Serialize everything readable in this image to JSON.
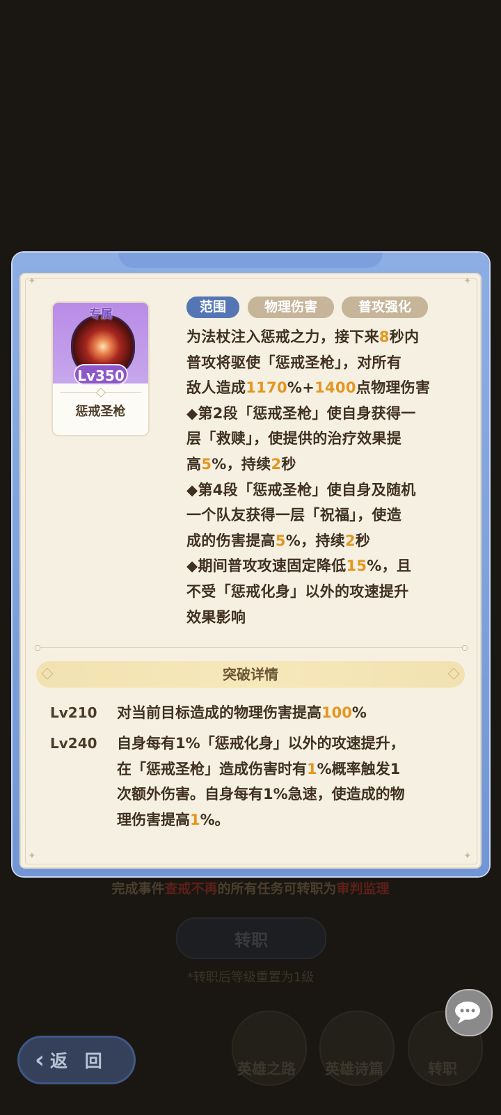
{
  "background": {
    "description_parts": [
      "完成事件",
      "查戒不再",
      "的所有任务可转职为",
      "审判监理"
    ],
    "job_change_button": "转职",
    "note": "*转职后等级重置为1级",
    "nav": [
      {
        "label": "英雄之路"
      },
      {
        "label": "英雄诗篇"
      },
      {
        "label": "转职"
      }
    ],
    "back_button": "返 回"
  },
  "skill": {
    "badge": "专属",
    "level": "Lv350",
    "name": "惩戒圣枪",
    "icon": "holy-spear-icon"
  },
  "tags": [
    "范围",
    "物理伤害",
    "普攻强化"
  ],
  "description_lines": [
    [
      {
        "t": "为法杖注入惩戒之力，接下来"
      },
      {
        "t": "8",
        "n": true
      },
      {
        "t": "秒内"
      }
    ],
    [
      {
        "t": "普攻将驱使「惩戒圣枪」，对所有"
      }
    ],
    [
      {
        "t": "敌人造成"
      },
      {
        "t": "1170",
        "n": true
      },
      {
        "t": "%+"
      },
      {
        "t": "1400",
        "n": true
      },
      {
        "t": "点物理伤害"
      }
    ],
    [
      {
        "t": "◆第2段「惩戒圣枪」使自身获得一"
      }
    ],
    [
      {
        "t": "层「救赎」，使提供的治疗效果提"
      }
    ],
    [
      {
        "t": "高"
      },
      {
        "t": "5",
        "n": true
      },
      {
        "t": "%，持续"
      },
      {
        "t": "2",
        "n": true
      },
      {
        "t": "秒"
      }
    ],
    [
      {
        "t": "◆第4段「惩戒圣枪」使自身及随机"
      }
    ],
    [
      {
        "t": "一个队友获得一层「祝福」，使造"
      }
    ],
    [
      {
        "t": "成的伤害提高"
      },
      {
        "t": "5",
        "n": true
      },
      {
        "t": "%，持续"
      },
      {
        "t": "2",
        "n": true
      },
      {
        "t": "秒"
      }
    ],
    [
      {
        "t": "◆期间普攻攻速固定降低"
      },
      {
        "t": "15",
        "n": true
      },
      {
        "t": "%，且"
      }
    ],
    [
      {
        "t": "不受「惩戒化身」以外的攻速提升"
      }
    ],
    [
      {
        "t": "效果影响"
      }
    ]
  ],
  "breakthrough": {
    "title": "突破详情",
    "items": [
      {
        "level": "Lv210",
        "lines": [
          [
            {
              "t": "对当前目标造成的物理伤害提高"
            },
            {
              "t": "100",
              "n": true
            },
            {
              "t": "%"
            }
          ]
        ]
      },
      {
        "level": "Lv240",
        "lines": [
          [
            {
              "t": "自身每有1%「惩戒化身」以外的攻速提升，"
            }
          ],
          [
            {
              "t": "在「惩戒圣枪」造成伤害时有"
            },
            {
              "t": "1",
              "n": true
            },
            {
              "t": "%概率触发1"
            }
          ],
          [
            {
              "t": "次额外伤害。自身每有1%急速，使造成的物"
            }
          ],
          [
            {
              "t": "理伤害提高"
            },
            {
              "t": "1",
              "n": true
            },
            {
              "t": "%。"
            }
          ]
        ]
      }
    ]
  },
  "colors": {
    "dialog_frame": "#7e9fde",
    "panel_bg": "#f6f0e2",
    "highlight_number": "#e3961f",
    "tag_active": "#5476b4",
    "tag_inactive": "#c7b59a",
    "level_badge": "#8d57c9"
  }
}
